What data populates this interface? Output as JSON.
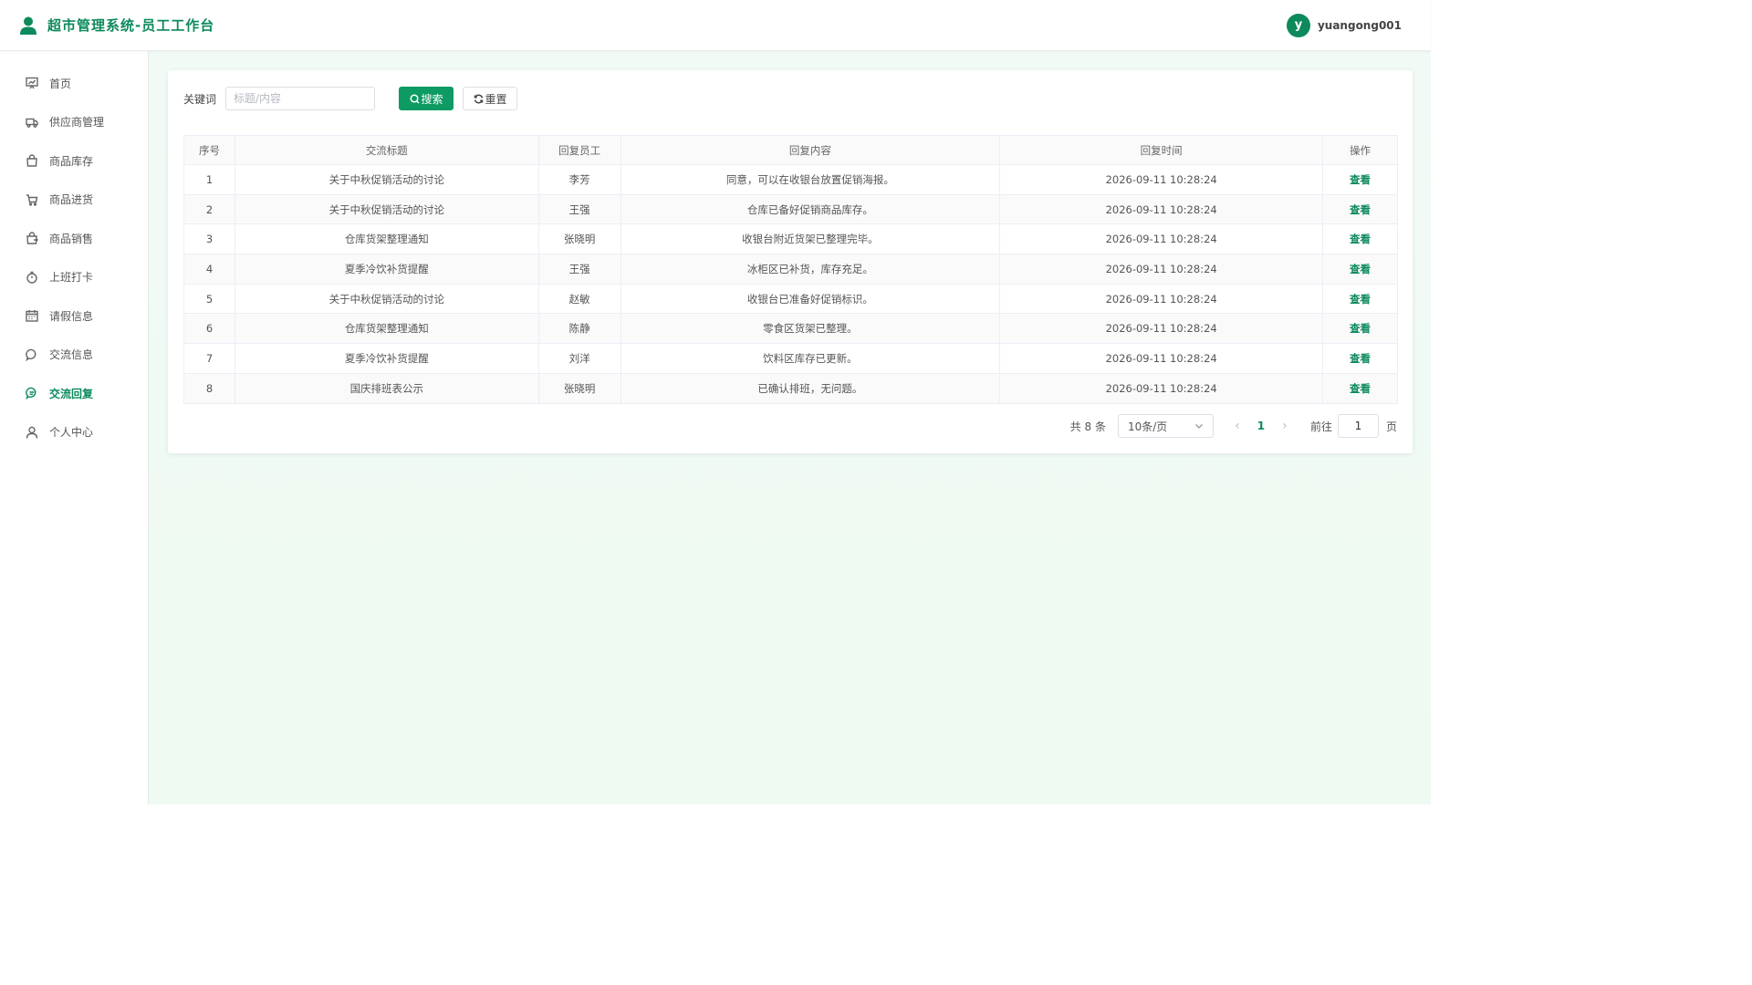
{
  "header": {
    "title": "超市管理系统-员工工作台",
    "avatar_letter": "y",
    "username": "yuangong001"
  },
  "sidebar": {
    "items": [
      {
        "label": "首页",
        "icon": "chart-board-icon"
      },
      {
        "label": "供应商管理",
        "icon": "truck-icon"
      },
      {
        "label": "商品库存",
        "icon": "bag-icon"
      },
      {
        "label": "商品进货",
        "icon": "cart-icon"
      },
      {
        "label": "商品销售",
        "icon": "sell-bag-icon"
      },
      {
        "label": "上班打卡",
        "icon": "stopwatch-icon"
      },
      {
        "label": "请假信息",
        "icon": "calendar-icon"
      },
      {
        "label": "交流信息",
        "icon": "chat-icon"
      },
      {
        "label": "交流回复",
        "icon": "chat-reply-icon",
        "active": true
      },
      {
        "label": "个人中心",
        "icon": "user-icon"
      }
    ]
  },
  "search": {
    "label": "关键词",
    "placeholder": "标题/内容",
    "value": "",
    "search_button": "搜索",
    "reset_button": "重置"
  },
  "table": {
    "headers": [
      "序号",
      "交流标题",
      "回复员工",
      "回复内容",
      "回复时间",
      "操作"
    ],
    "rows": [
      {
        "seq": "1",
        "title": "关于中秋促销活动的讨论",
        "staff": "李芳",
        "content": "同意，可以在收银台放置促销海报。",
        "time": "2026-09-11 10:28:24",
        "action": "查看"
      },
      {
        "seq": "2",
        "title": "关于中秋促销活动的讨论",
        "staff": "王强",
        "content": "仓库已备好促销商品库存。",
        "time": "2026-09-11 10:28:24",
        "action": "查看"
      },
      {
        "seq": "3",
        "title": "仓库货架整理通知",
        "staff": "张晓明",
        "content": "收银台附近货架已整理完毕。",
        "time": "2026-09-11 10:28:24",
        "action": "查看"
      },
      {
        "seq": "4",
        "title": "夏季冷饮补货提醒",
        "staff": "王强",
        "content": "冰柜区已补货，库存充足。",
        "time": "2026-09-11 10:28:24",
        "action": "查看"
      },
      {
        "seq": "5",
        "title": "关于中秋促销活动的讨论",
        "staff": "赵敏",
        "content": "收银台已准备好促销标识。",
        "time": "2026-09-11 10:28:24",
        "action": "查看"
      },
      {
        "seq": "6",
        "title": "仓库货架整理通知",
        "staff": "陈静",
        "content": "零食区货架已整理。",
        "time": "2026-09-11 10:28:24",
        "action": "查看"
      },
      {
        "seq": "7",
        "title": "夏季冷饮补货提醒",
        "staff": "刘洋",
        "content": "饮料区库存已更新。",
        "time": "2026-09-11 10:28:24",
        "action": "查看"
      },
      {
        "seq": "8",
        "title": "国庆排班表公示",
        "staff": "张晓明",
        "content": "已确认排班，无问题。",
        "time": "2026-09-11 10:28:24",
        "action": "查看"
      }
    ]
  },
  "pagination": {
    "total_text": "共 8 条",
    "page_size": "10条/页",
    "current_page": "1",
    "goto_label": "前往",
    "goto_value": "1",
    "goto_suffix": "页"
  },
  "colors": {
    "accent": "#0d8a5c",
    "button": "#0d9a63",
    "background": "#eefaf2"
  }
}
